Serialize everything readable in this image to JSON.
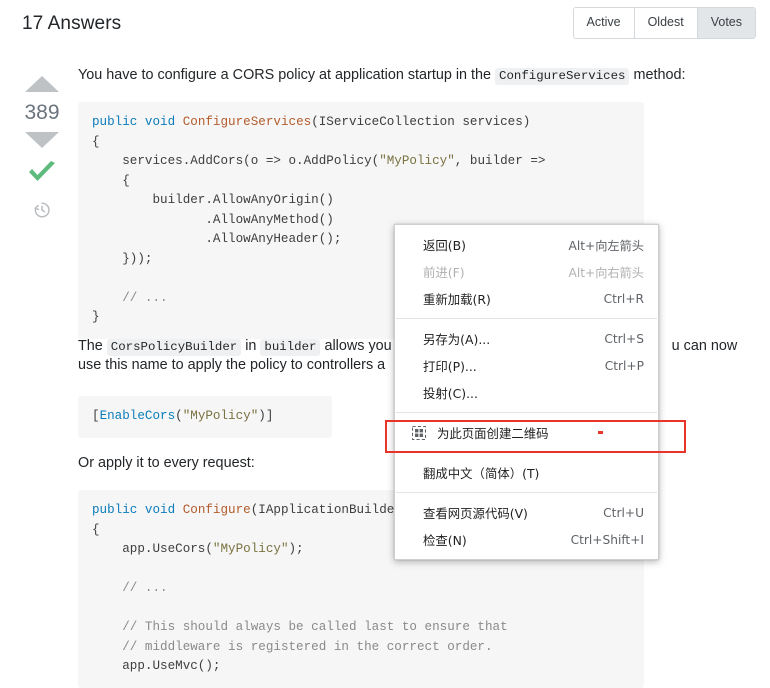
{
  "header": {
    "answers_title": "17 Answers",
    "tabs": [
      {
        "label": "Active",
        "selected": false
      },
      {
        "label": "Oldest",
        "selected": false
      },
      {
        "label": "Votes",
        "selected": true
      }
    ]
  },
  "vote": {
    "score": "389",
    "up_arrow": "upvote-arrow",
    "down_arrow": "downvote-arrow",
    "accepted": "accepted-checkmark",
    "history": "history-clock-icon",
    "accent_green": "#5eba7d",
    "arrow_gray": "#bfc2c5"
  },
  "post": {
    "paragraph_1_a": "You have to configure a CORS policy at application startup in the ",
    "paragraph_1_code": "ConfigureServices",
    "paragraph_1_b": " method:",
    "code_block_1": "public void ConfigureServices(IServiceCollection services)\n{\n    services.AddCors(o => o.AddPolicy(\"MyPolicy\", builder =>\n    {\n        builder.AllowAnyOrigin()\n               .AllowAnyMethod()\n               .AllowAnyHeader();\n    }));\n\n    // ...\n}",
    "paragraph_2_a": "The ",
    "paragraph_2_code1": "CorsPolicyBuilder",
    "paragraph_2_b": " in ",
    "paragraph_2_code2": "builder",
    "paragraph_2_c": " allows you t",
    "paragraph_2_d": "u can now",
    "paragraph_2_line2": "use this name to apply the policy to controllers a",
    "code_block_2": "[EnableCors(\"MyPolicy\")]",
    "paragraph_3": "Or apply it to every request:",
    "code_block_3": "public void Configure(IApplicationBuilder app)\n{\n    app.UseCors(\"MyPolicy\");\n\n    // ...\n\n    // This should always be called last to ensure that\n    // middleware is registered in the correct order.\n    app.UseMvc();"
  },
  "context_menu": {
    "groups": [
      [
        {
          "label": "返回(B)",
          "accel": "Alt+向左箭头",
          "disabled": false,
          "icon": null,
          "name": "back"
        },
        {
          "label": "前进(F)",
          "accel": "Alt+向右箭头",
          "disabled": true,
          "icon": null,
          "name": "forward"
        },
        {
          "label": "重新加载(R)",
          "accel": "Ctrl+R",
          "disabled": false,
          "icon": null,
          "name": "reload"
        }
      ],
      [
        {
          "label": "另存为(A)...",
          "accel": "Ctrl+S",
          "disabled": false,
          "icon": null,
          "name": "save-as"
        },
        {
          "label": "打印(P)...",
          "accel": "Ctrl+P",
          "disabled": false,
          "icon": null,
          "name": "print"
        },
        {
          "label": "投射(C)...",
          "accel": "",
          "disabled": false,
          "icon": null,
          "name": "cast"
        }
      ],
      [
        {
          "label": "为此页面创建二维码",
          "accel": "",
          "disabled": false,
          "icon": "qr-code-icon",
          "name": "create-qr-code"
        }
      ],
      [
        {
          "label": "翻成中文（简体）(T)",
          "accel": "",
          "disabled": false,
          "icon": null,
          "name": "translate-to-chinese"
        }
      ],
      [
        {
          "label": "查看网页源代码(V)",
          "accel": "Ctrl+U",
          "disabled": false,
          "icon": null,
          "name": "view-page-source"
        },
        {
          "label": "检查(N)",
          "accel": "Ctrl+Shift+I",
          "disabled": false,
          "icon": null,
          "name": "inspect"
        }
      ]
    ],
    "highlight_color": "#e8352a"
  }
}
